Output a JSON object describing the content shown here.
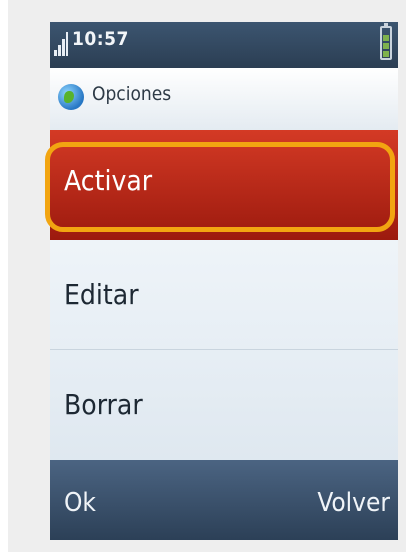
{
  "status_bar": {
    "time": "10:57"
  },
  "header": {
    "title": "Opciones"
  },
  "menu": {
    "items": [
      {
        "label": "Activar",
        "selected": true
      },
      {
        "label": "Editar",
        "selected": false
      },
      {
        "label": "Borrar",
        "selected": false
      }
    ]
  },
  "soft_keys": {
    "left": "Ok",
    "right": "Volver"
  },
  "colors": {
    "selected_item": "#c42d1c",
    "highlight_ring": "#f2a511",
    "status_bar": "#34495f"
  }
}
